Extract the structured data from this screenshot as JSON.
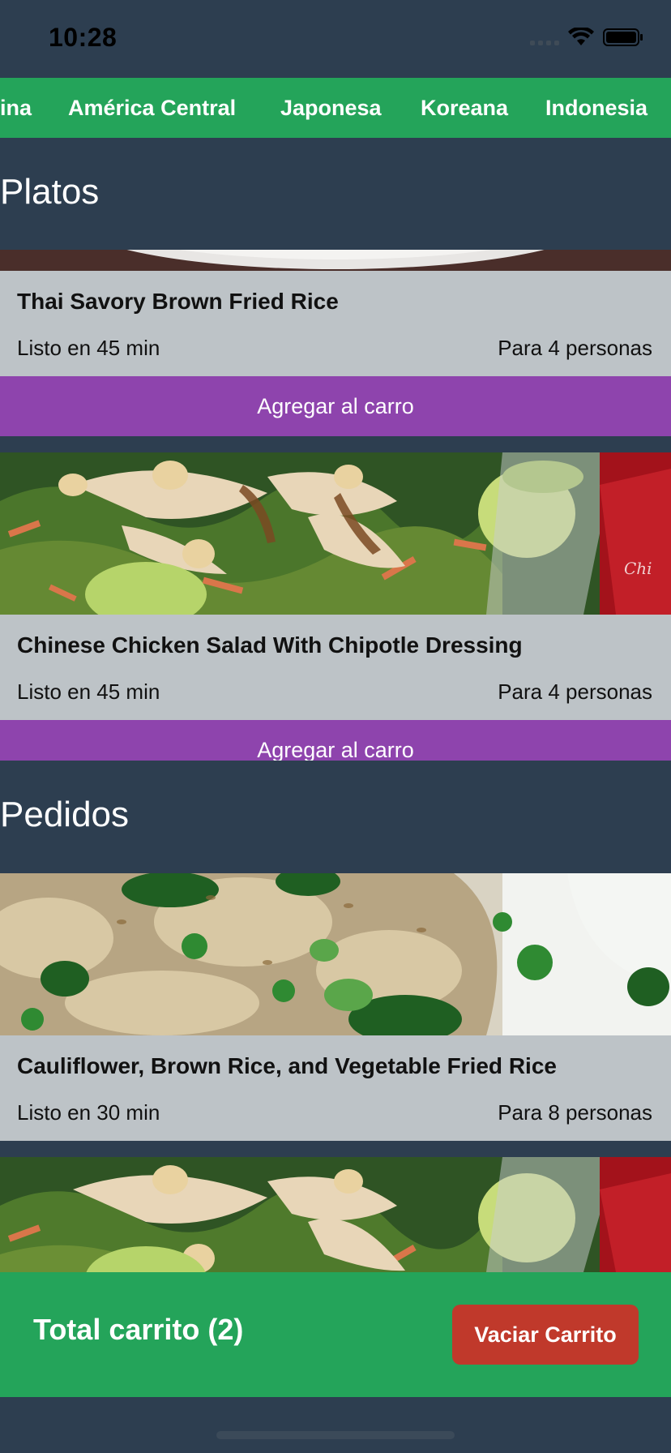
{
  "status": {
    "time": "10:28"
  },
  "categories": [
    "ina",
    "América Central",
    "Japonesa",
    "Koreana",
    "Indonesia"
  ],
  "sections": {
    "dishes_title": "Platos",
    "orders_title": "Pedidos"
  },
  "dishes": [
    {
      "title": "Thai Savory Brown Fried Rice",
      "time": "Listo en 45 min",
      "people": "Para 4 personas",
      "button": "Agregar al carro"
    },
    {
      "title": "Chinese Chicken Salad With Chipotle Dressing",
      "time": "Listo en 45 min",
      "people": "Para 4 personas",
      "button": "Agregar al carro"
    }
  ],
  "orders": [
    {
      "title": "Cauliflower, Brown Rice, and Vegetable Fried Rice",
      "time": "Listo en 30 min",
      "people": "Para 8 personas"
    }
  ],
  "footer": {
    "total_label": "Total carrito (2)",
    "empty_button": "Vaciar Carrito"
  },
  "colors": {
    "background": "#2d3e50",
    "accent_green": "#24a45a",
    "purple_button": "#8e44ad",
    "red_button": "#c0392b",
    "card_info": "#bdc3c7"
  }
}
